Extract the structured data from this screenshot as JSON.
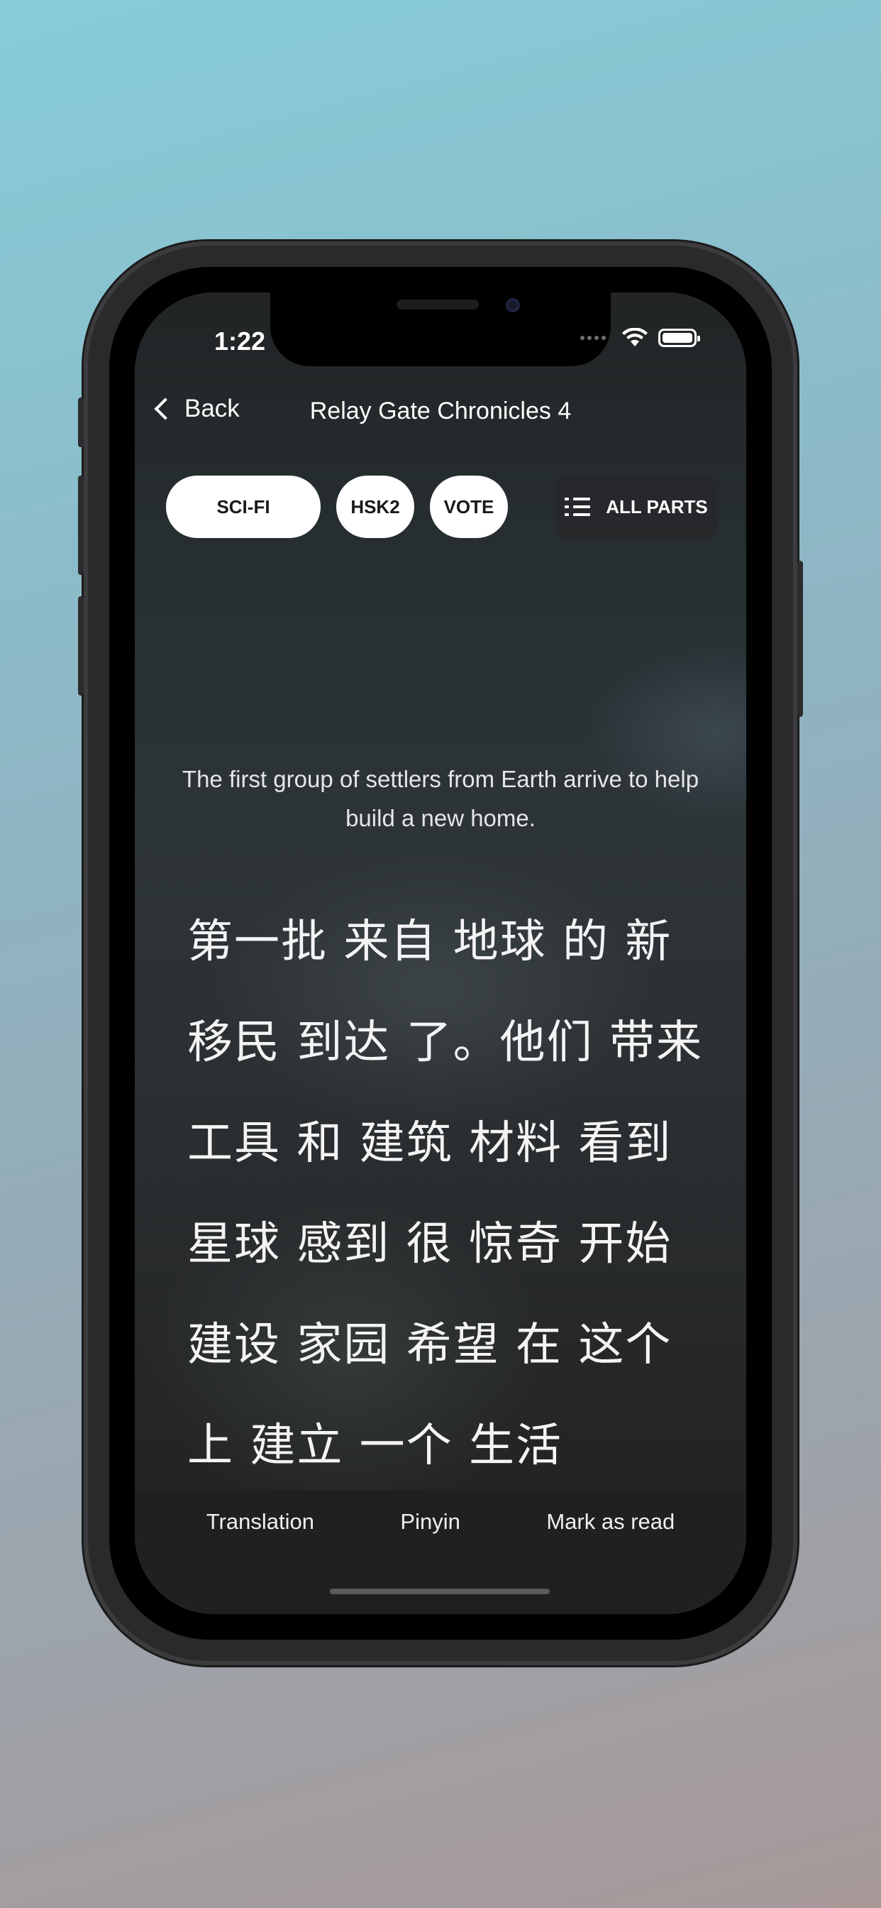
{
  "status_bar": {
    "time": "1:22"
  },
  "nav": {
    "back_label": "Back",
    "title": "Relay Gate Chronicles 4"
  },
  "chips": {
    "genre": "SCI-FI",
    "level": "HSK2",
    "vote": "VOTE",
    "all_parts": "ALL PARTS"
  },
  "story": {
    "summary": "The first group of settlers from Earth arrive to help build a new home.",
    "lines": [
      "第一批 来自 地球 的 新",
      "移民 到达 了。他们 带来",
      "工具 和 建筑 材料 看到",
      "星球 感到 很 惊奇 开始",
      "建设 家园 希望 在 这个",
      "上 建立 一个 生活"
    ]
  },
  "bottom_bar": {
    "translation": "Translation",
    "pinyin": "Pinyin",
    "mark_read": "Mark as read"
  },
  "icons": {
    "back": "chevron-left-icon",
    "list": "list-icon",
    "wifi": "wifi-icon",
    "battery": "battery-icon"
  }
}
